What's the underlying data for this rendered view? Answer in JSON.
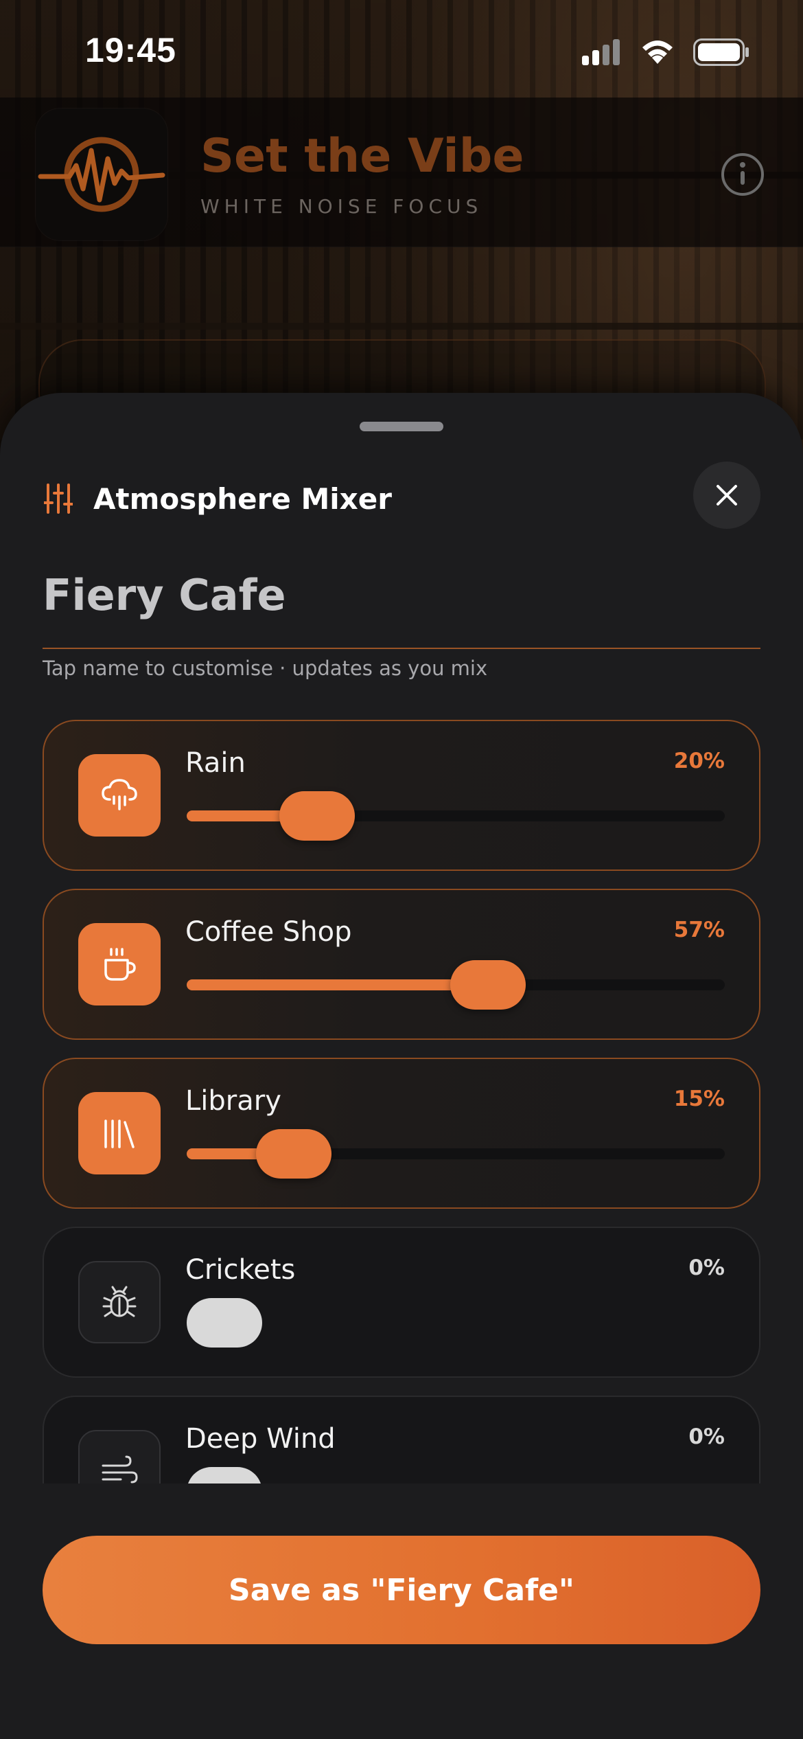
{
  "status_bar": {
    "time": "19:45",
    "icons": [
      "cellular-signal-icon",
      "wifi-icon",
      "battery-icon"
    ]
  },
  "header": {
    "title": "Set the Vibe",
    "subtitle": "WHITE NOISE FOCUS",
    "logo_icon": "waveform-logo-icon",
    "info_icon": "info-icon"
  },
  "sheet": {
    "title": "Atmosphere Mixer",
    "title_icon": "sliders-icon",
    "close_icon": "close-icon",
    "preset_name": "Fiery Cafe",
    "preset_hint": "Tap name to customise · updates as you mix",
    "tracks": [
      {
        "label": "Rain",
        "percent": "20%",
        "level": 0.2,
        "active": true,
        "icon": "rain-cloud-icon"
      },
      {
        "label": "Coffee Shop",
        "percent": "57%",
        "level": 0.57,
        "active": true,
        "icon": "coffee-cup-icon"
      },
      {
        "label": "Library",
        "percent": "15%",
        "level": 0.15,
        "active": true,
        "icon": "books-icon"
      },
      {
        "label": "Crickets",
        "percent": "0%",
        "level": 0,
        "active": false,
        "icon": "bug-icon"
      },
      {
        "label": "Deep Wind",
        "percent": "0%",
        "level": 0,
        "active": false,
        "icon": "wind-icon"
      }
    ],
    "save_label": "Save as \"Fiery Cafe\""
  },
  "colors": {
    "accent": "#e8783a",
    "sheet_bg": "#1c1c1e",
    "title_brown": "#7a3e18"
  }
}
